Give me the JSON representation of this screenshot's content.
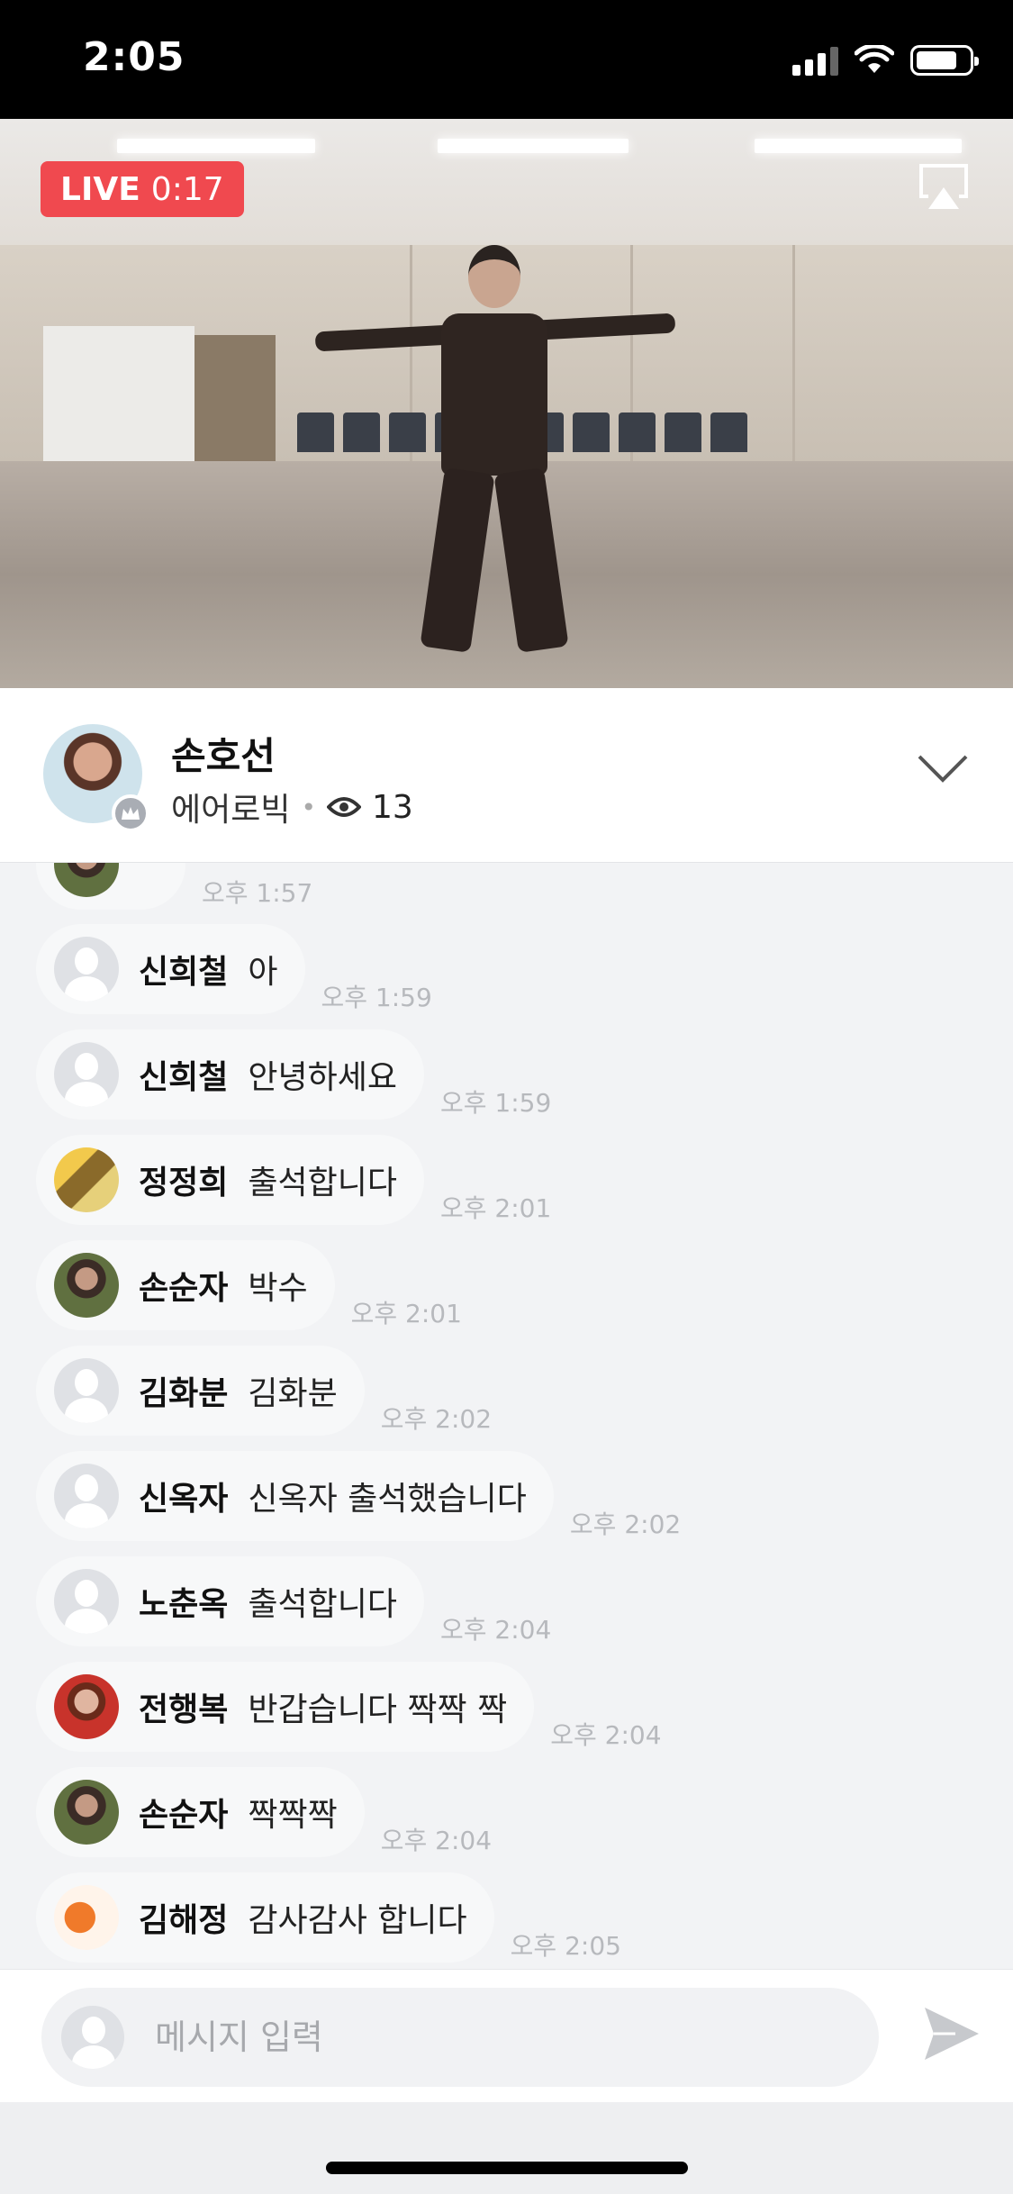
{
  "status_bar": {
    "time": "2:05"
  },
  "video": {
    "live_label": "LIVE",
    "duration": "0:17"
  },
  "host": {
    "name": "손호선",
    "category": "에어로빅",
    "viewer_count": "13"
  },
  "chat": {
    "partial_time": "오후 1:57",
    "messages": [
      {
        "sender": "신희철",
        "text": "아",
        "time": "오후 1:59",
        "avatar": "default-avatar"
      },
      {
        "sender": "신희철",
        "text": "안녕하세요",
        "time": "오후 1:59",
        "avatar": "default-avatar"
      },
      {
        "sender": "정정희",
        "text": "출석합니다",
        "time": "오후 2:01",
        "avatar": "photo-avatar"
      },
      {
        "sender": "손순자",
        "text": "박수",
        "time": "오후 2:01",
        "avatar": "photo-avatar"
      },
      {
        "sender": "김화분",
        "text": "김화분",
        "time": "오후 2:02",
        "avatar": "default-avatar"
      },
      {
        "sender": "신옥자",
        "text": "신옥자 출석했습니다",
        "time": "오후 2:02",
        "avatar": "default-avatar"
      },
      {
        "sender": "노춘옥",
        "text": "출석합니다",
        "time": "오후 2:04",
        "avatar": "default-avatar"
      },
      {
        "sender": "전행복",
        "text": "반갑습니다 짝짝 짝",
        "time": "오후 2:04",
        "avatar": "photo-avatar"
      },
      {
        "sender": "손순자",
        "text": "짝짝짝",
        "time": "오후 2:04",
        "avatar": "photo-avatar"
      },
      {
        "sender": "김해정",
        "text": "감사감사 합니다",
        "time": "오후 2:05",
        "avatar": "photo-avatar"
      }
    ]
  },
  "input": {
    "placeholder": "메시지 입력"
  },
  "colors": {
    "live_red": "#f0494f",
    "chat_bg": "#f2f3f5",
    "time_gray": "#b7b9bd"
  }
}
